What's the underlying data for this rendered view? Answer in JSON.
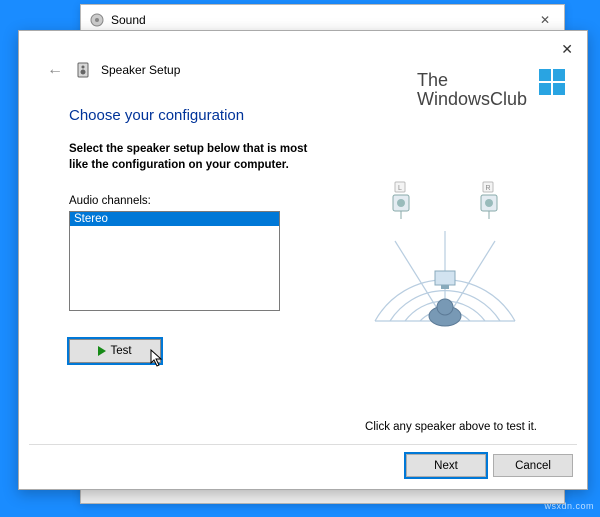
{
  "sound_window": {
    "title": "Sound"
  },
  "setup": {
    "title": "Speaker Setup",
    "heading": "Choose your configuration",
    "instruction": "Select the speaker setup below that is most like the configuration on your computer.",
    "channels_label": "Audio channels:",
    "channels": [
      "Stereo"
    ],
    "selected_channel": "Stereo",
    "test_label": "Test",
    "hint": "Click any speaker above to test it.",
    "speakers": {
      "left_label": "L",
      "right_label": "R"
    }
  },
  "logo": {
    "line1": "The",
    "line2": "WindowsClub"
  },
  "buttons": {
    "next": "Next",
    "cancel": "Cancel"
  },
  "watermark": "wsxdn.com"
}
